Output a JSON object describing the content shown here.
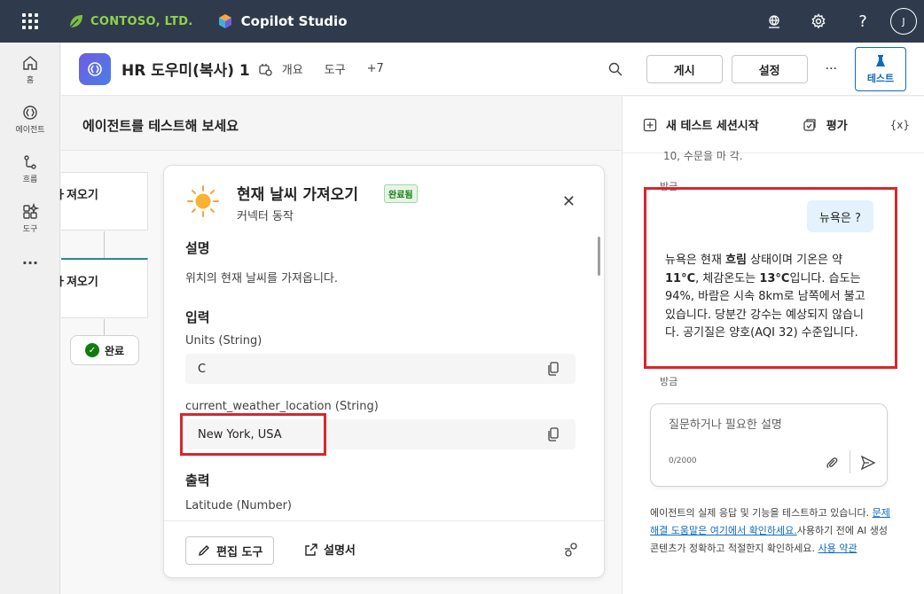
{
  "topbar": {
    "brand": "CONTOSO, LTD.",
    "product": "Copilot Studio",
    "avatar_initial": "J"
  },
  "leftrail": {
    "items": [
      {
        "label": "홈",
        "icon": "home-icon"
      },
      {
        "label": "에이전트",
        "icon": "agent-icon"
      },
      {
        "label": "흐름",
        "icon": "flow-icon"
      },
      {
        "label": "도구",
        "icon": "tools-icon"
      },
      {
        "label": "...",
        "icon": "more-icon"
      }
    ]
  },
  "header": {
    "agent_name": "HR 도우미(복사) 1",
    "tabs": [
      "개요",
      "도구",
      "+7"
    ],
    "publish": "게시",
    "settings": "설정",
    "more": "···",
    "test": "테스트"
  },
  "canvas": {
    "title": "에이전트를 테스트해 보세요",
    "node1_title": "ㅏ져오기",
    "node2_title": "ㅏ져오기",
    "done": "완료"
  },
  "detail": {
    "title": "현재 날씨 가져오기",
    "badge": "완료됨",
    "subtitle": "커넥터 동작",
    "desc_heading": "설명",
    "desc_text": "위치의 현재 날씨를 가져옵니다.",
    "input_heading": "입력",
    "units_label": "Units (String)",
    "units_value": "C",
    "location_label": "current_weather_location (String)",
    "location_value": "New York, USA",
    "output_heading": "출력",
    "latitude_label": "Latitude (Number)",
    "edit_tool": "편집 도구",
    "docs": "설명서"
  },
  "chat": {
    "new_session": "새 테스트 세션시작",
    "evaluate": "평가",
    "variables": "{x}",
    "cut_text": "10, 수문을 마 각.",
    "time1": "방금",
    "user_message": "뉴욕은 ?",
    "bot_parts": [
      "뉴욕은 현재 ",
      "흐림",
      " 상태이며 기온은 약 ",
      "11°C",
      ", 체감온도는 ",
      "13°C",
      "입니다. 습도는 94%, 바람은 시속 8km로 남쪽에서 불고 있습니다. 당분간 강수는 예상되지 않습니다. 공기질은 양호(AQI 32) 수준입니다."
    ],
    "time2": "방금",
    "placeholder": "질문하거나 필요한 설명",
    "counter": "0/2000",
    "disclaimer_1": "에이전트의 실제 응답 및 기능을 테스트하고 있습니다.",
    "disclaimer_link": "문제 해결 도움말은 여기에서 확인하세요.",
    "disclaimer_2": "사용하기 전에 AI 생성 콘텐츠가 정확하고 적절한지 확인하세요.",
    "disclaimer_link2": "사용 약관"
  },
  "colors": {
    "topbar": "#2f3b4c",
    "accent": "#0f6cbd",
    "highlight": "#d9262c",
    "success": "#107c10"
  }
}
